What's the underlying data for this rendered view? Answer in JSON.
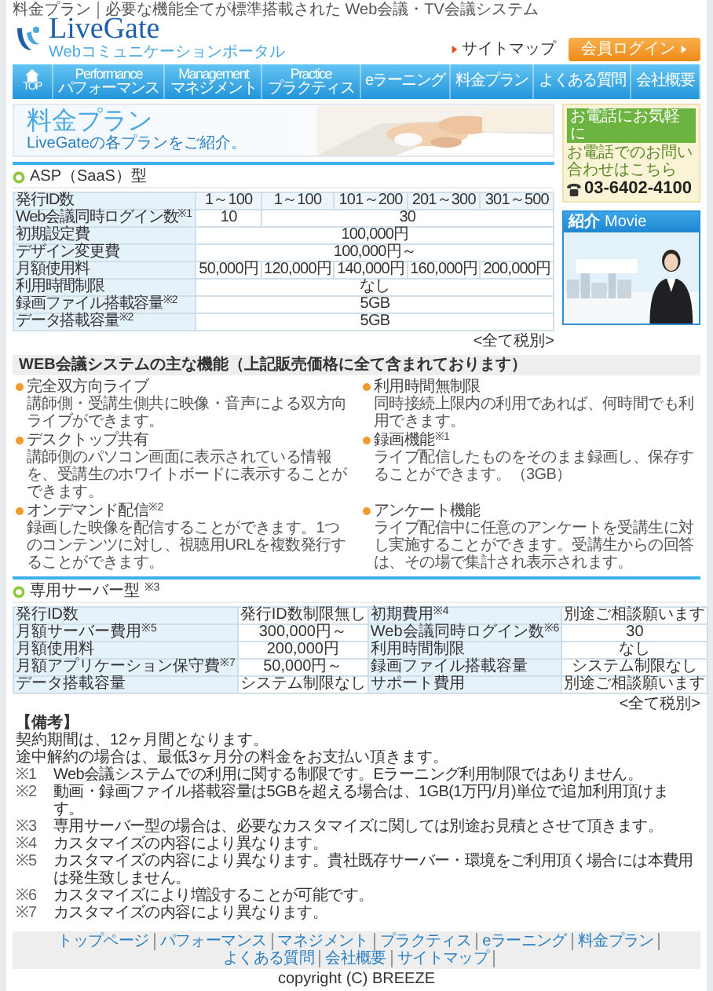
{
  "top_bar": {
    "breadcrumb": "料金プラン",
    "tagline": "必要な機能全てが標準搭載された Web会議・TV会議システム"
  },
  "header": {
    "logo": "LiveGate",
    "logo_subtitle": "Webコミュニケーションポータル",
    "sitemap_link": "サイトマップ",
    "login_button": "会員ログイン"
  },
  "nav": [
    {
      "kind": "home",
      "label": "TOP"
    },
    {
      "kind": "double",
      "label": "Performance",
      "sublabel": "パフォーマンス"
    },
    {
      "kind": "double",
      "label": "Management",
      "sublabel": "マネジメント"
    },
    {
      "kind": "double",
      "label": "Practice",
      "sublabel": "プラクティス"
    },
    {
      "kind": "single",
      "label": "eラーニング"
    },
    {
      "kind": "single",
      "label": "料金プラン"
    },
    {
      "kind": "single",
      "label": "よくある質問"
    },
    {
      "kind": "single",
      "label": "会社概要"
    }
  ],
  "banner": {
    "title": "料金プラン",
    "subtitle": "LiveGateの各プランをご紹介。"
  },
  "contact": {
    "badge": "お電話にお気軽に",
    "caption": "お電話でのお問い合わせはこちら",
    "phone": "03-6402-4100"
  },
  "movie": {
    "title": "紹介",
    "title_en": "Movie"
  },
  "asp_plan": {
    "heading": "ASP（SaaS）型",
    "rows": [
      {
        "label": "発行ID数",
        "cells": [
          "1～100",
          "1～100",
          "101～200",
          "201～300",
          "301～500"
        ]
      },
      {
        "label": "Web会議同時ログイン数$^{※1}$",
        "cells": [
          "10",
          {
            "text": "30",
            "colspan": 4
          }
        ]
      },
      {
        "label": "初期設定費",
        "cells": [
          {
            "text": "100,000円",
            "colspan": 5
          }
        ]
      },
      {
        "label": "デザイン変更費",
        "cells": [
          {
            "text": "100,000円～",
            "colspan": 5
          }
        ]
      },
      {
        "label": "月額使用料",
        "cells": [
          "50,000円",
          "120,000円",
          "140,000円",
          "160,000円",
          "200,000円"
        ]
      },
      {
        "label": "利用時間制限",
        "cells": [
          {
            "text": "なし",
            "colspan": 5
          }
        ]
      },
      {
        "label": "録画ファイル搭載容量$^{※2}$",
        "cells": [
          {
            "text": "5GB",
            "colspan": 5
          }
        ]
      },
      {
        "label": "データ搭載容量$^{※2}$",
        "cells": [
          {
            "text": "5GB",
            "colspan": 5
          }
        ]
      }
    ],
    "tax_note": "<全て税別>"
  },
  "features": {
    "heading": "WEB会議システムの主な機能（上記販売価格に全て含まれております）",
    "items": [
      {
        "title": "完全双方向ライブ",
        "text": "講師側・受講生側共に映像・音声による双方向ライブができます。"
      },
      {
        "title": "利用時間無制限",
        "text": "同時接続上限内の利用であれば、何時間でも利用できます。"
      },
      {
        "title": "デスクトップ共有",
        "text": "講師側のパソコン画面に表示されている情報を、受講生のホワイトボードに表示することができます。"
      },
      {
        "title": "録画機能$^{※1}$",
        "text": "ライブ配信したものをそのまま録画し、保存することができます。（3GB）"
      },
      {
        "title": "オンデマンド配信$^{※2}$",
        "text": "録画した映像を配信することができます。1つのコンテンツに対し、視聴用URLを複数発行することができます。"
      },
      {
        "title": "アンケート機能",
        "text": "ライブ配信中に任意のアンケートを受講生に対し実施することができます。受講生からの回答は、その場で集計され表示されます。"
      }
    ]
  },
  "server_plan": {
    "heading": "専用サーバー型 $^{※3}$",
    "rows": [
      {
        "label": "発行ID数",
        "value": "発行ID数制限無し"
      },
      {
        "label": "初期費用$^{※4}$",
        "value": "別途ご相談願います"
      },
      {
        "label": "月額サーバー費用$^{※5}$",
        "value": "300,000円～"
      },
      {
        "label": "Web会議同時ログイン数$^{※6}$",
        "value": "30"
      },
      {
        "label": "月額使用料",
        "value": "200,000円"
      },
      {
        "label": "利用時間制限",
        "value": "なし"
      },
      {
        "label": "月額アプリケーション保守費$^{※7}$",
        "value": "50,000円～"
      },
      {
        "label": "録画ファイル搭載容量",
        "value": "システム制限なし"
      },
      {
        "label": "データ搭載容量",
        "value": "システム制限なし"
      },
      {
        "label": "サポート費用",
        "value": "別途ご相談願います"
      }
    ],
    "tax_note": "<全て税別>"
  },
  "notes": {
    "heading": "【備考】",
    "lines": [
      "契約期間は、12ヶ月間となります。",
      "途中解約の場合は、最低3ヶ月分の料金をお支払い頂きます。"
    ],
    "footnotes": [
      {
        "mark": "※1",
        "text": "Web会議システムでの利用に関する制限です。Eラーニング利用制限ではありません。"
      },
      {
        "mark": "※2",
        "text": "動画・録画ファイル搭載容量は5GBを超える場合は、1GB(1万円/月)単位で追加利用頂けます。"
      },
      {
        "mark": "※3",
        "text": "専用サーバー型の場合は、必要なカスタマイズに関しては別途お見積とさせて頂きます。"
      },
      {
        "mark": "※4",
        "text": "カスタマイズの内容により異なります。"
      },
      {
        "mark": "※5",
        "text": "カスタマイズの内容により異なります。貴社既存サーバー・環境をご利用頂く場合には本費用は発生致しません。"
      },
      {
        "mark": "※6",
        "text": "カスタマイズにより増設することが可能です。"
      },
      {
        "mark": "※7",
        "text": "カスタマイズの内容により異なります。"
      }
    ]
  },
  "footer": {
    "links": [
      "トップページ",
      "パフォーマンス",
      "マネジメント",
      "プラクティス",
      "eラーニング",
      "料金プラン",
      "よくある質問",
      "会社概要",
      "サイトマップ"
    ],
    "copyright": "copyright (C) BREEZE"
  }
}
